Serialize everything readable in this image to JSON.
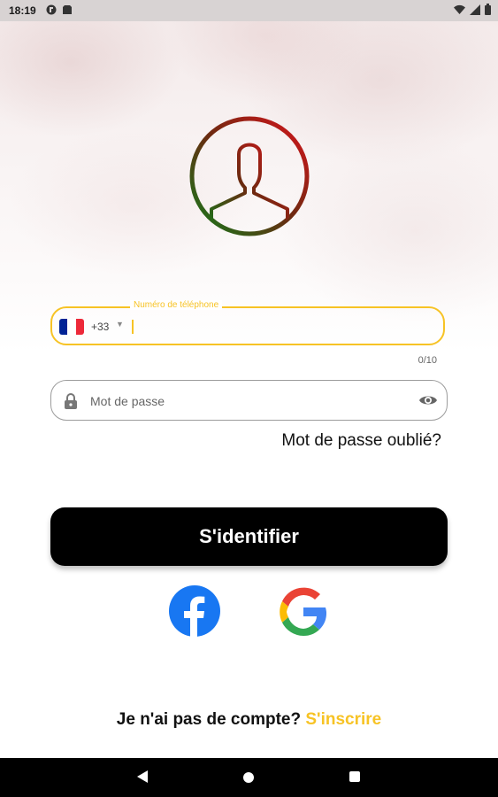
{
  "status": {
    "time": "18:19"
  },
  "phone": {
    "label": "Numéro de téléphone",
    "dial_code": "+33",
    "counter": "0/10",
    "flag_colors": [
      "#002395",
      "#ffffff",
      "#ed2939"
    ]
  },
  "password": {
    "placeholder": "Mot de passe"
  },
  "forgot_link": "Mot de passe oublié?",
  "login_button": "S'identifier",
  "signup": {
    "question": "Je n'ai pas de compte?",
    "link": "S'inscrire"
  },
  "colors": {
    "accent": "#f7c325",
    "button": "#000000"
  },
  "icons": [
    "user-avatar-icon",
    "lock-icon",
    "eye-icon",
    "facebook-icon",
    "google-icon",
    "dropdown-arrow-icon"
  ]
}
